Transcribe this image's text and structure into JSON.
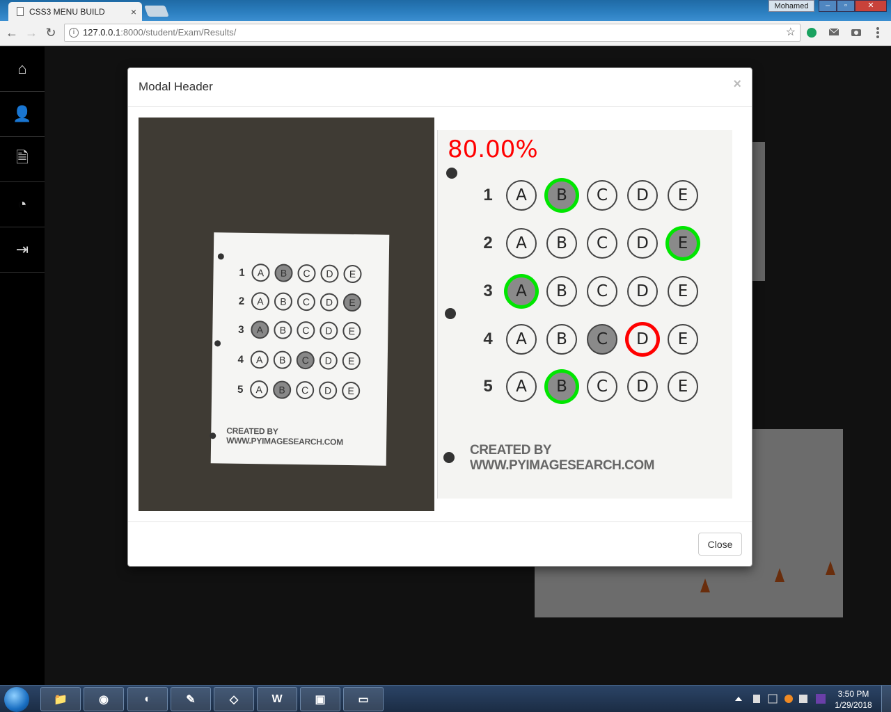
{
  "browser": {
    "tab_title": "CSS3 MENU BUILD",
    "tab_close": "×",
    "user": "Mohamed",
    "url_host": "127.0.0.1",
    "url_path": ":8000/student/Exam/Results/",
    "back_icon": "←",
    "forward_icon": "→",
    "reload_icon": "↻",
    "info_icon": "i",
    "star_icon": "☆",
    "win_min": "–",
    "win_max": "▫",
    "win_close": "✕"
  },
  "sidebar": {
    "items": [
      {
        "icon": "home-icon",
        "glyph": "⌂"
      },
      {
        "icon": "user-icon",
        "glyph": "👤"
      },
      {
        "icon": "document-icon",
        "glyph": "🗎"
      },
      {
        "icon": "pie-chart-icon",
        "glyph": "◔"
      },
      {
        "icon": "logout-icon",
        "glyph": "⇥"
      }
    ]
  },
  "modal": {
    "title": "Modal Header",
    "close_x": "×",
    "close_button": "Close"
  },
  "answer_sheet": {
    "credit": "CREATED BY WWW.PYIMAGESEARCH.COM",
    "choices": [
      "A",
      "B",
      "C",
      "D",
      "E"
    ],
    "questions": [
      "1",
      "2",
      "3",
      "4",
      "5"
    ],
    "filled": [
      "B",
      "E",
      "A",
      "C",
      "B"
    ]
  },
  "graded": {
    "score": "80.00%",
    "correct_color": "#00e600",
    "wrong_color": "#ff0000",
    "results": [
      {
        "q": "1",
        "marked": "B",
        "status": "correct"
      },
      {
        "q": "2",
        "marked": "E",
        "status": "correct"
      },
      {
        "q": "3",
        "marked": "A",
        "status": "correct"
      },
      {
        "q": "4",
        "marked": "C",
        "status": "wrong",
        "answer": "D"
      },
      {
        "q": "5",
        "marked": "B",
        "status": "correct"
      }
    ]
  },
  "taskbar": {
    "time": "3:50 PM",
    "date": "1/29/2018",
    "apps": [
      "explorer",
      "chrome",
      "app-3",
      "notepad-plus",
      "app-5",
      "word",
      "app-7",
      "cmd"
    ]
  }
}
